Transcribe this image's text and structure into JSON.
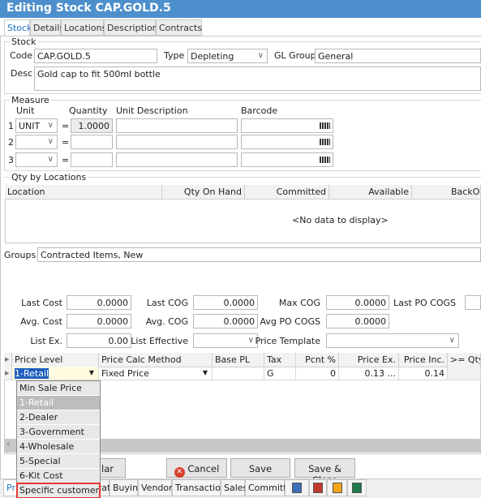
{
  "window": {
    "title": "Editing Stock CAP.GOLD.5"
  },
  "tabs": [
    "Stock",
    "Details",
    "Locations",
    "Descriptions",
    "Contracts"
  ],
  "stock": {
    "group_label": "Stock",
    "code_label": "Code",
    "code": "CAP.GOLD.5",
    "type_label": "Type",
    "type": "Depleting",
    "gl_group_label": "GL Group",
    "gl_group": "General",
    "desc_label": "Desc",
    "desc": "Gold cap to fit 500ml bottle"
  },
  "measure": {
    "group_label": "Measure",
    "headers": [
      "Unit",
      "Quantity",
      "Unit Description",
      "Barcode"
    ],
    "rows": [
      {
        "num": "1",
        "unit": "UNIT",
        "eq": "=",
        "qty": "1.0000"
      },
      {
        "num": "2",
        "unit": "",
        "eq": "=",
        "qty": ""
      },
      {
        "num": "3",
        "unit": "",
        "eq": "=",
        "qty": ""
      }
    ]
  },
  "qty_locations": {
    "group_label": "Qty by Locations",
    "headers": [
      "Location",
      "Qty On Hand",
      "Committed",
      "Available",
      "BackOr"
    ],
    "empty": "<No data to display>"
  },
  "groups": {
    "label": "Groups",
    "value": "Contracted Items, New"
  },
  "costs": {
    "last_cost_label": "Last Cost",
    "last_cost": "0.0000",
    "last_cog_label": "Last COG",
    "last_cog": "0.0000",
    "max_cog_label": "Max COG",
    "max_cog": "0.0000",
    "last_po_cogs_label": "Last PO COGS",
    "avg_cost_label": "Avg. Cost",
    "avg_cost": "0.0000",
    "avg_cog_label": "Avg. COG",
    "avg_cog": "0.0000",
    "avg_po_cogs_label": "Avg PO COGS",
    "avg_po_cogs": "0.0000",
    "list_ex_label": "List Ex.",
    "list_ex": "0.00",
    "list_effective_label": "List Effective",
    "price_template_label": "Price Template"
  },
  "price_grid": {
    "headers": [
      "Price Level",
      "Price Calc Method",
      "Base PL",
      "Tax",
      "Pcnt %",
      "Price Ex.",
      "Price Inc.",
      ">= Qty"
    ],
    "row": {
      "price_level": "1-Retail",
      "calc_method": "Fixed Price",
      "base_pl": "",
      "tax": "G",
      "pcnt": "0",
      "price_ex": "0.13 ...",
      "price_inc": "0.14"
    }
  },
  "dropdown": {
    "items": [
      "Min Sale Price",
      "1-Retail",
      "2-Dealer",
      "3-Government",
      "4-Wholesale",
      "5-Special",
      "6-Kit Cost",
      "Specific customer..."
    ],
    "selected": "1-Retail",
    "highlighted": "Specific customer..."
  },
  "buttons": {
    "similar": "milar",
    "cancel": "Cancel",
    "save": "Save",
    "save_close": "Save & Close"
  },
  "bottom_tabs": {
    "pricing": "Pri",
    "items": [
      "Stats",
      "Buying",
      "Vendors",
      "Transactions",
      "Sales",
      "Committed"
    ],
    "icons": [
      "report-icon",
      "book-icon",
      "copy-icon",
      "gift-icon"
    ]
  },
  "colors": {
    "title_bar": "#4d8fcc",
    "active_tab": "#1e70c0",
    "highlight_border": "#e53935",
    "cancel_icon": "#d9412f"
  }
}
